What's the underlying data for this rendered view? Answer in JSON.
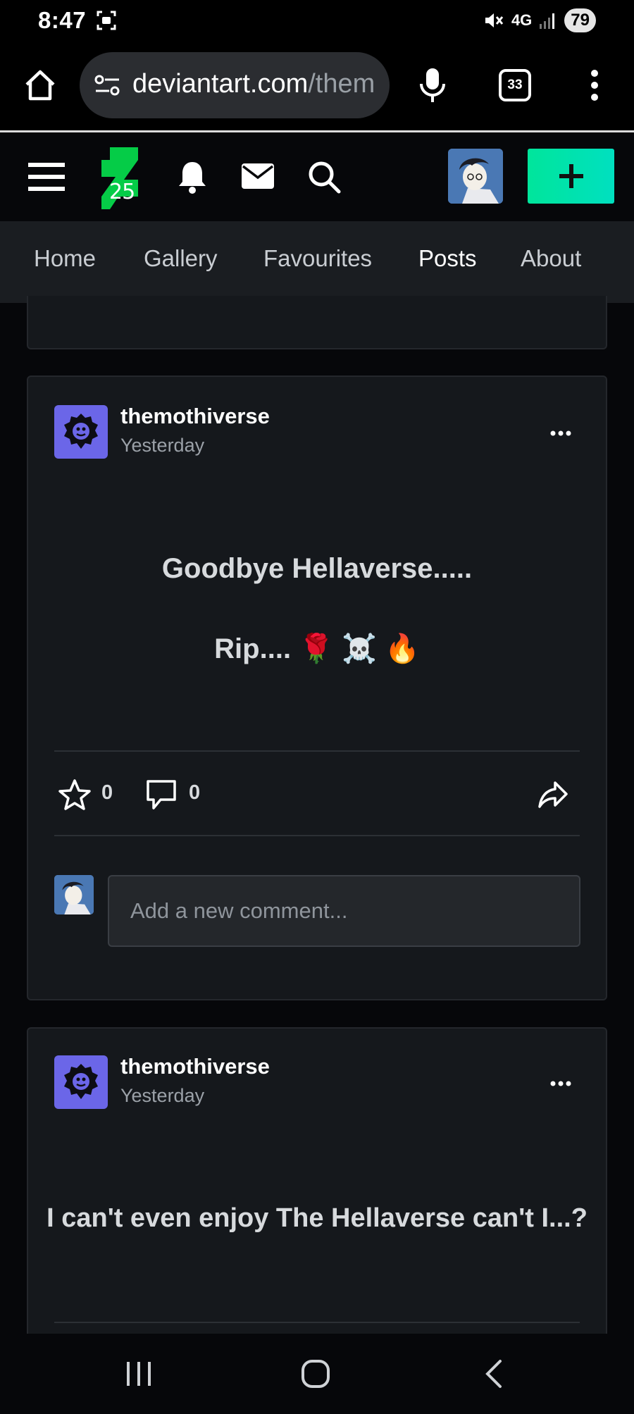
{
  "status_bar": {
    "time": "8:47",
    "network": "4G",
    "battery": "79"
  },
  "browser": {
    "url_main": "deviantart.com",
    "url_rest": "/them",
    "tab_count": "33"
  },
  "tabs": [
    {
      "label": "Home"
    },
    {
      "label": "Gallery"
    },
    {
      "label": "Favourites"
    },
    {
      "label": "Posts"
    },
    {
      "label": "About"
    }
  ],
  "logo_number": "25",
  "posts": [
    {
      "username": "themothiverse",
      "time": "Yesterday",
      "line1": "Goodbye Hellaverse.....",
      "line2": "Rip.... 🌹 ☠️ 🔥",
      "favourites": "0",
      "comments": "0",
      "comment_placeholder": "Add a new comment..."
    },
    {
      "username": "themothiverse",
      "time": "Yesterday",
      "line1": "I can't even enjoy The Hellaverse can't I...?"
    }
  ],
  "colors": {
    "accent": "#1ae0a0",
    "avatar_purple": "#6b66e8",
    "card_bg": "#15181c"
  }
}
